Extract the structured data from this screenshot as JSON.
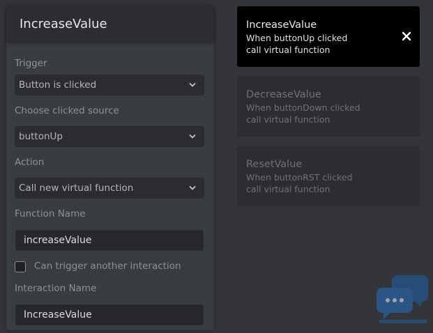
{
  "panel": {
    "title": "IncreaseValue",
    "trigger": {
      "label": "Trigger",
      "value": "Button is clicked"
    },
    "clicked_source": {
      "label": "Choose clicked source",
      "value": "buttonUp"
    },
    "action": {
      "label": "Action",
      "value": "Call new virtual function"
    },
    "function_name": {
      "label": "Function Name",
      "value": "increaseValue"
    },
    "can_trigger_another": {
      "label": "Can trigger another interaction",
      "checked": false
    },
    "interaction_name": {
      "label": "Interaction Name",
      "value": "IncreaseValue"
    }
  },
  "interactions": [
    {
      "title": "IncreaseValue",
      "line1": "When buttonUp clicked",
      "line2": "call virtual function",
      "active": true
    },
    {
      "title": "DecreaseValue",
      "line1": "When buttonDown clicked",
      "line2": "call virtual function",
      "active": false
    },
    {
      "title": "ResetValue",
      "line1": "When buttonRST clicked",
      "line2": "call virtual function",
      "active": false
    }
  ],
  "icons": {
    "chevron": "chevron-down-icon",
    "close": "close-icon",
    "watermark": "chat-bubbles-icon"
  },
  "colors": {
    "background": "#333538",
    "panel": "#393c40",
    "header": "#2b2d30",
    "active_card": "#000000",
    "inactive_card": "#2b2d30",
    "watermark": "#1e5fa8"
  }
}
